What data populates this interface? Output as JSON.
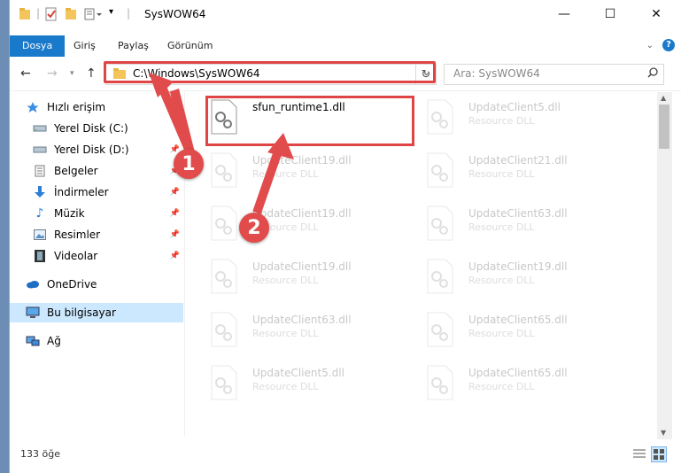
{
  "window": {
    "title": "SysWOW64",
    "controls": {
      "minimize": "—",
      "maximize": "☐",
      "close": "✕"
    }
  },
  "ribbon": {
    "tabs": [
      {
        "label": "Dosya",
        "active": true
      },
      {
        "label": "Giriş"
      },
      {
        "label": "Paylaş"
      },
      {
        "label": "Görünüm"
      }
    ],
    "help": "?"
  },
  "nav": {
    "address": "C:\\Windows\\SysWOW64",
    "search_placeholder": "Ara: SysWOW64"
  },
  "sidebar": {
    "items": [
      {
        "label": "Hızlı erişim",
        "icon": "star-icon"
      },
      {
        "label": "Yerel Disk (C:)",
        "icon": "drive-icon"
      },
      {
        "label": "Yerel Disk (D:)",
        "icon": "drive-icon"
      },
      {
        "label": "Belgeler",
        "icon": "documents-icon"
      },
      {
        "label": "İndirmeler",
        "icon": "download-icon"
      },
      {
        "label": "Müzik",
        "icon": "music-icon"
      },
      {
        "label": "Resimler",
        "icon": "pictures-icon"
      },
      {
        "label": "Videolar",
        "icon": "video-icon"
      },
      {
        "label": "OneDrive",
        "icon": "cloud-icon"
      },
      {
        "label": "Bu bilgisayar",
        "icon": "computer-icon"
      },
      {
        "label": "Ağ",
        "icon": "network-icon"
      }
    ]
  },
  "files": [
    {
      "name": "sfun_runtime1.dll",
      "type": ""
    },
    {
      "name": "UpdateClient5.dll",
      "type": "Resource DLL"
    },
    {
      "name": "UpdateClient19.dll",
      "type": "Resource DLL"
    },
    {
      "name": "UpdateClient21.dll",
      "type": "Resource DLL"
    },
    {
      "name": "UpdateClient19.dll",
      "type": "Resource DLL"
    },
    {
      "name": "UpdateClient63.dll",
      "type": "Resource DLL"
    },
    {
      "name": "UpdateClient19.dll",
      "type": "Resource DLL"
    },
    {
      "name": "UpdateClient19.dll",
      "type": "Resource DLL"
    },
    {
      "name": "UpdateClient63.dll",
      "type": "Resource DLL"
    },
    {
      "name": "UpdateClient65.dll",
      "type": "Resource DLL"
    },
    {
      "name": "UpdateClient5.dll",
      "type": "Resource DLL"
    },
    {
      "name": "UpdateClient65.dll",
      "type": "Resource DLL"
    }
  ],
  "status": {
    "count": "133 öğe"
  },
  "annotations": {
    "badge1": "1",
    "badge2": "2",
    "color": "#e14b4b"
  }
}
